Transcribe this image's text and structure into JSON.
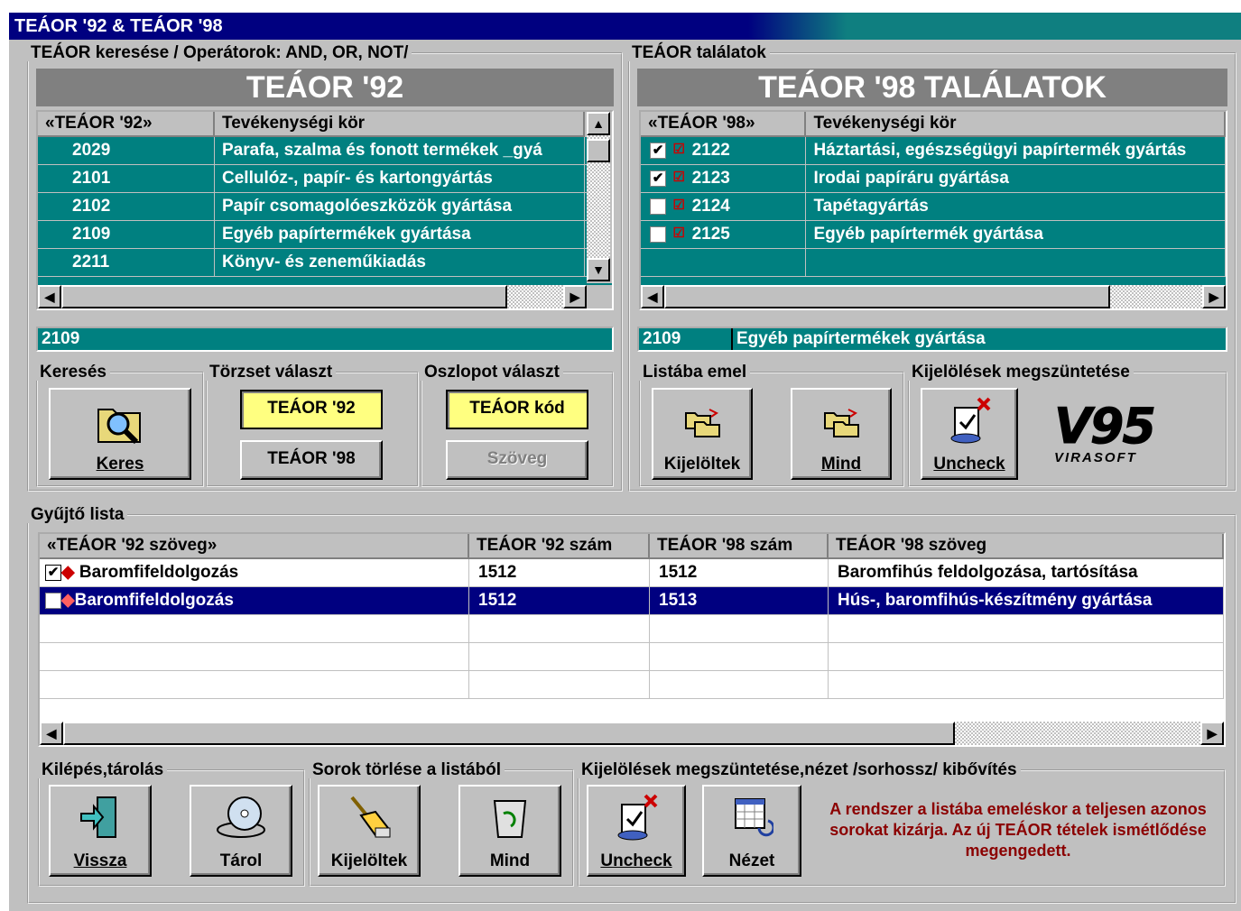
{
  "window": {
    "title": "TEÁOR '92 & TEÁOR '98"
  },
  "left_group": {
    "legend": "TEÁOR keresése / Operátorok: AND, OR, NOT/",
    "banner": "TEÁOR '92",
    "columns": [
      "«TEÁOR '92»",
      "Tevékenységi kör"
    ],
    "rows": [
      {
        "code": "2029",
        "text": "Parafa, szalma és fonott termékek _gyá"
      },
      {
        "code": "2101",
        "text": "Cellulóz-, papír- és kartongyártás"
      },
      {
        "code": "2102",
        "text": "Papír csomagolóeszközök gyártása"
      },
      {
        "code": "2109",
        "text": "Egyéb papírtermékek gyártása"
      },
      {
        "code": "2211",
        "text": "Könyv- és zeneműkiadás"
      }
    ],
    "search_value": "2109"
  },
  "right_group": {
    "legend": "TEÁOR találatok",
    "banner": "TEÁOR '98 TALÁLATOK",
    "columns": [
      "«TEÁOR '98»",
      "Tevékenységi kör"
    ],
    "rows": [
      {
        "checked": true,
        "code": "2122",
        "text": "Háztartási, egészségügyi papírtermék gyártás"
      },
      {
        "checked": true,
        "code": "2123",
        "text": "Irodai papíráru gyártása"
      },
      {
        "checked": false,
        "code": "2124",
        "text": "Tapétagyártás"
      },
      {
        "checked": false,
        "code": "2125",
        "text": "Egyéb papírtermék gyártása"
      }
    ],
    "selected_code": "2109",
    "selected_text": "Egyéb papírtermékek gyártása"
  },
  "search_group": {
    "legend": "Keresés",
    "button": "Keres"
  },
  "torzs_group": {
    "legend": "Törzset választ",
    "opt1": "TEÁOR '92",
    "opt2": "TEÁOR '98"
  },
  "oszlop_group": {
    "legend": "Oszlopot választ",
    "opt1": "TEÁOR kód",
    "opt2": "Szöveg"
  },
  "listaba_group": {
    "legend": "Listába emel",
    "btn1": "Kijelöltek",
    "btn2": "Mind"
  },
  "kijelol_group": {
    "legend": "Kijelölések megszüntetése",
    "btn1": "Uncheck",
    "logo_top": "V95",
    "logo_bottom": "VIRASOFT"
  },
  "collect_group": {
    "legend": "Gyűjtő lista",
    "columns": [
      "«TEÁOR '92 szöveg»",
      "TEÁOR '92 szám",
      "TEÁOR '98 szám",
      "TEÁOR '98 szöveg"
    ],
    "rows": [
      {
        "checked": true,
        "text92": "Baromfifeldolgozás",
        "num92": "1512",
        "num98": "1512",
        "text98": "Baromfihús feldolgozása, tartósítása"
      },
      {
        "checked": false,
        "text92": "Baromfifeldolgozás",
        "num92": "1512",
        "num98": "1513",
        "text98": "Hús-, baromfihús-készítmény gyártása"
      }
    ]
  },
  "exit_group": {
    "legend": "Kilépés,tárolás",
    "btn1": "Vissza",
    "btn2": "Tárol"
  },
  "delete_group": {
    "legend": "Sorok törlése a listából",
    "btn1": "Kijelöltek",
    "btn2": "Mind"
  },
  "view_group": {
    "legend": "Kijelölések megszüntetése,nézet /sorhossz/ kibővítés",
    "btn1": "Uncheck",
    "btn2": "Nézet"
  },
  "note": "A rendszer a listába emeléskor a teljesen azonos sorokat kizárja. Az új TEÁOR tételek  ismétlődése megengedett.",
  "colors": {
    "teal": "#008080",
    "navy": "#000080",
    "note_red": "#8b0000",
    "yellow": "#ffff80"
  }
}
